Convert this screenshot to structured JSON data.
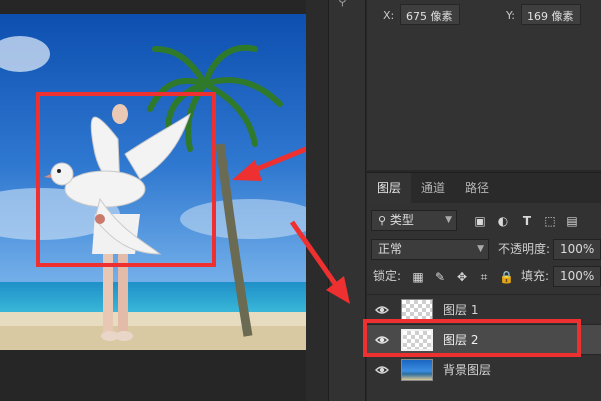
{
  "properties": {
    "x_label": "X:",
    "x_value": "675 像素",
    "y_label": "Y:",
    "y_value": "169 像素"
  },
  "layers_panel": {
    "tabs": [
      {
        "label": "图层",
        "active": true
      },
      {
        "label": "通道",
        "active": false
      },
      {
        "label": "路径",
        "active": false
      }
    ],
    "filter_kind": "类型",
    "blend_mode": "正常",
    "opacity_label": "不透明度:",
    "opacity_value": "100%",
    "lock_label": "锁定:",
    "fill_label": "填充:",
    "fill_value": "100%",
    "layers": [
      {
        "name": "图层 1",
        "selected": false,
        "visible": true,
        "thumbnail": "transparent"
      },
      {
        "name": "图层 2",
        "selected": true,
        "visible": true,
        "thumbnail": "transparent"
      },
      {
        "name": "背景图层",
        "selected": false,
        "visible": true,
        "thumbnail": "beach-photo"
      }
    ]
  },
  "colors": {
    "annotation": "#ee3030",
    "panel": "#323232",
    "selected_row": "#4a4a4a"
  }
}
